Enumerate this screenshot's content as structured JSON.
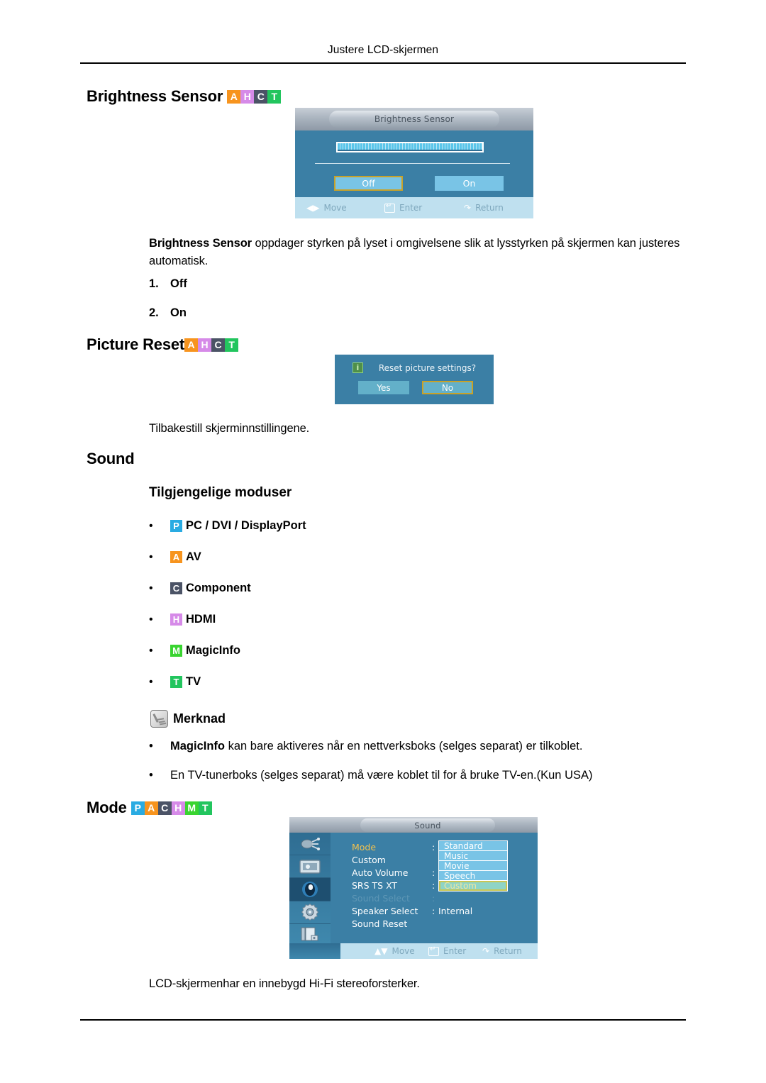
{
  "page": {
    "running_header": "Justere LCD-skjermen"
  },
  "brightness_sensor": {
    "heading": "Brightness Sensor",
    "badges": [
      "A",
      "H",
      "C",
      "T"
    ],
    "osd": {
      "title": "Brightness Sensor",
      "button_off": "Off",
      "button_on": "On",
      "selected": "Off",
      "footer": {
        "move": "Move",
        "enter": "Enter",
        "return": "Return"
      }
    },
    "description_bold": "Brightness Sensor",
    "description_rest": " oppdager styrken på lyset i omgivelsene slik at lysstyrken på skjermen kan justeres automatisk.",
    "options": [
      {
        "num": "1.",
        "label": "Off"
      },
      {
        "num": "2.",
        "label": "On"
      }
    ]
  },
  "picture_reset": {
    "heading": "Picture Reset",
    "badges": [
      "A",
      "H",
      "C",
      "T"
    ],
    "dialog": {
      "icon": "info-icon",
      "question": "Reset picture settings?",
      "button_yes": "Yes",
      "button_no": "No",
      "selected": "No"
    },
    "description": "Tilbakestill skjerminnstillingene."
  },
  "sound": {
    "heading": "Sound",
    "subheading": "Tilgjengelige moduser",
    "modes": [
      {
        "badge": "P",
        "label": "PC / DVI / DisplayPort"
      },
      {
        "badge": "A",
        "label": "AV"
      },
      {
        "badge": "C",
        "label": "Component"
      },
      {
        "badge": "H",
        "label": "HDMI"
      },
      {
        "badge": "M",
        "label": "MagicInfo"
      },
      {
        "badge": "T",
        "label": "TV"
      }
    ],
    "note": {
      "title": "Merknad",
      "items": [
        {
          "bold": "MagicInfo",
          "rest": " kan bare aktiveres når en nettverksboks (selges separat) er tilkoblet."
        },
        {
          "bold": "",
          "rest": "En TV-tunerboks (selges separat) må være koblet til for å bruke TV-en.(Kun USA)"
        }
      ]
    }
  },
  "mode": {
    "heading": "Mode",
    "badges": [
      "P",
      "A",
      "C",
      "H",
      "M",
      "T"
    ],
    "osd": {
      "title": "Sound",
      "sidebar_icons": [
        "input-icon",
        "picture-icon",
        "sound-icon",
        "setup-icon",
        "multi-control-icon"
      ],
      "active_sidebar": "sound-icon",
      "rows": [
        {
          "label": "Mode",
          "colon": ":",
          "state": "gold"
        },
        {
          "label": "Custom",
          "colon": "",
          "state": "normal"
        },
        {
          "label": "Auto Volume",
          "colon": ":",
          "state": "normal"
        },
        {
          "label": "SRS TS XT",
          "colon": ":",
          "state": "normal"
        },
        {
          "label": "Sound Select",
          "colon": ":",
          "state": "dim"
        },
        {
          "label": "Speaker Select",
          "colon": ":",
          "state": "normal"
        },
        {
          "label": "Sound Reset",
          "colon": "",
          "state": "normal"
        }
      ],
      "dropdown": [
        "Standard",
        "Music",
        "Movie",
        "Speech",
        "Custom"
      ],
      "dropdown_selected": "Custom",
      "speaker_value": "Internal",
      "footer": {
        "move": "Move",
        "enter": "Enter",
        "return": "Return"
      }
    },
    "description": "LCD-skjermenhar en innebygd Hi-Fi stereoforsterker."
  },
  "colors": {
    "badge_P": "#29abe2",
    "badge_A": "#f7941e",
    "badge_C": "#4b5366",
    "badge_H": "#d68ae8",
    "badge_M": "#39d430",
    "badge_T": "#22c55e",
    "osd_body": "#3b7fa5",
    "osd_button": "#79c4e6",
    "osd_selected_border": "#c9a227",
    "osd_footer": "#bfe0ef",
    "gold_text": "#f2c14e"
  }
}
